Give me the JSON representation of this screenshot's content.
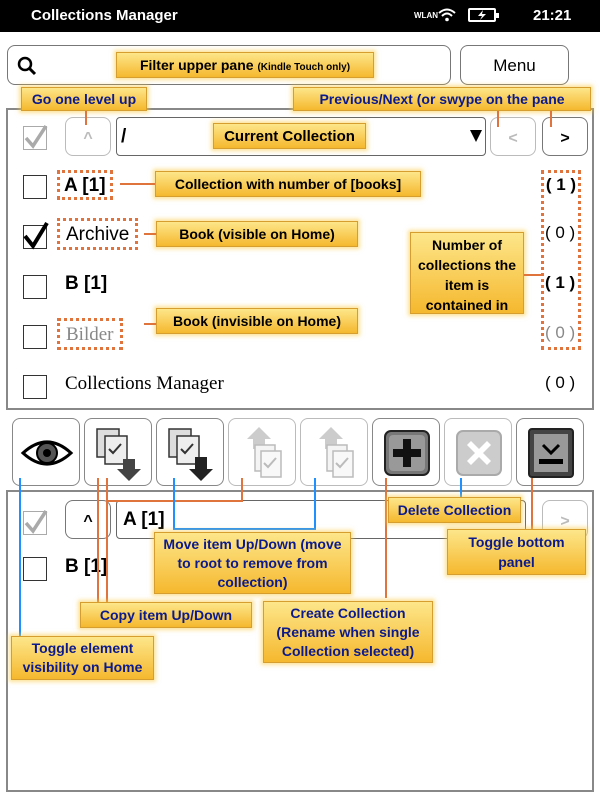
{
  "statusbar": {
    "title": "Collections Manager",
    "wlan": "WLAN",
    "time": "21:21"
  },
  "top": {
    "filter_label": "Filter upper pane",
    "filter_note": "(Kindle Touch only)",
    "menu_label": "Menu"
  },
  "annotations": {
    "level_up": "Go one level up",
    "prev_next": "Previous/Next (or swype on the pane",
    "current_collection": "Current Collection",
    "collection_books": "Collection with number of [books]",
    "book_visible": "Book (visible on Home)",
    "num_collections": "Number of collections the item is contained in",
    "book_invisible": "Book (invisible on Home)",
    "delete_collection": "Delete Collection",
    "toggle_bottom": "Toggle bottom panel",
    "move_item": "Move item Up/Down (move to root to remove from collection)",
    "copy_item": "Copy item Up/Down",
    "create_collection": "Create Collection (Rename when single Collection selected)",
    "toggle_visibility": "Toggle element visibility on Home"
  },
  "upper_pane": {
    "up_symbol": "^",
    "path": "/",
    "prev": "<",
    "next": ">",
    "items": [
      {
        "label": "A [1]",
        "count": "( 1 )"
      },
      {
        "label": "Archive",
        "count": "( 0 )"
      },
      {
        "label": "B [1]",
        "count": "( 1 )"
      },
      {
        "label": "Bilder",
        "count": "( 0 )"
      },
      {
        "label": "Collections Manager",
        "count": "( 0 )"
      }
    ]
  },
  "toolbar": {
    "icons": [
      "eye-icon",
      "copy-down-icon",
      "move-down-icon",
      "copy-up-icon",
      "move-up-icon",
      "plus-icon",
      "delete-icon",
      "toggle-panel-icon"
    ]
  },
  "lower_pane": {
    "up_symbol": "^",
    "path": "A [1]",
    "next": ">",
    "items": [
      {
        "label": "B [1]"
      }
    ]
  },
  "colors": {
    "annotation": "#f5b82e",
    "orange_line": "#e0743d",
    "blue_line": "#1e90ff"
  }
}
